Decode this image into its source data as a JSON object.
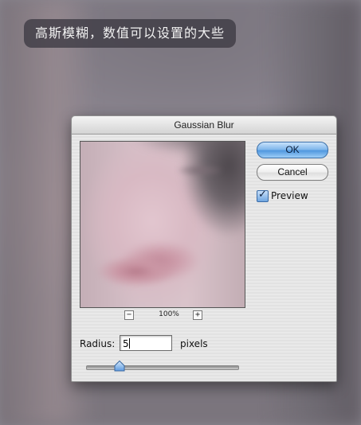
{
  "caption": {
    "text": "高斯模糊，数值可以设置的大些"
  },
  "dialog": {
    "title": "Gaussian Blur",
    "buttons": {
      "ok_label": "OK",
      "cancel_label": "Cancel"
    },
    "preview_checkbox": {
      "label": "Preview",
      "checked": true
    },
    "zoom": {
      "minus_symbol": "−",
      "plus_symbol": "+",
      "level": "100%"
    },
    "radius": {
      "label": "Radius:",
      "value": "5",
      "units": "pixels"
    },
    "slider": {
      "min": 0.1,
      "max": 250,
      "value_fraction": 0.22
    }
  },
  "colors": {
    "ok_button": "#6aa8e6",
    "backdrop": "#8a8790"
  },
  "icons": {
    "slider_thumb": "slider-thumb-icon",
    "check": "check-icon"
  }
}
